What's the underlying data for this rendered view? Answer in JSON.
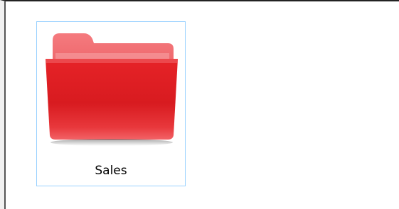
{
  "folder": {
    "label": "Sales",
    "icon": "red-folder-icon",
    "selected": true
  },
  "colors": {
    "folder_front": "#e21f24",
    "folder_back": "#f06a6e",
    "selection_border": "#99d1ff",
    "frame_border": "#222222"
  }
}
